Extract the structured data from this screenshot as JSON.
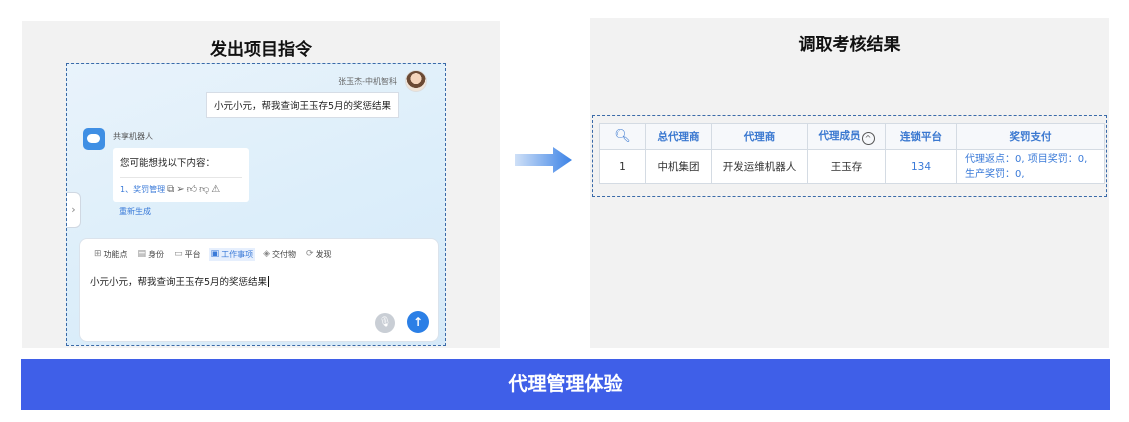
{
  "left_panel": {
    "title": "发出项目指令",
    "user_name": "张玉杰-中机智科",
    "user_message": "小元小元，帮我查询王玉存5月的奖惩结果",
    "bot_name": "共享机器人",
    "bot_message": "您可能想找以下内容：",
    "bot_link": "1、奖罚管理",
    "regenerate": "重新生成",
    "tools": [
      {
        "icon": "⊞",
        "label": "功能点"
      },
      {
        "icon": "▤",
        "label": "身份"
      },
      {
        "icon": "▭",
        "label": "平台"
      },
      {
        "icon": "▣",
        "label": "工作事项"
      },
      {
        "icon": "◈",
        "label": "交付物"
      },
      {
        "icon": "⟳",
        "label": "发现"
      }
    ],
    "input_value": "小元小元，帮我查询王玉存5月的奖惩结果"
  },
  "right_panel": {
    "title": "调取考核结果",
    "headers": [
      "总代理商",
      "代理商",
      "代理成员",
      "连锁平台",
      "奖罚支付"
    ],
    "row": {
      "index": "1",
      "general_agent": "中机集团",
      "agent": "开发运维机器人",
      "member": "王玉存",
      "platform": "134",
      "reward_line1": "代理返点：0, 项目奖罚：0,",
      "reward_line2": "生产奖罚：0,"
    }
  },
  "banner": "代理管理体验",
  "colors": {
    "accent": "#2b7fe6",
    "banner": "#3f5fe8",
    "header_text": "#3a78d0"
  }
}
